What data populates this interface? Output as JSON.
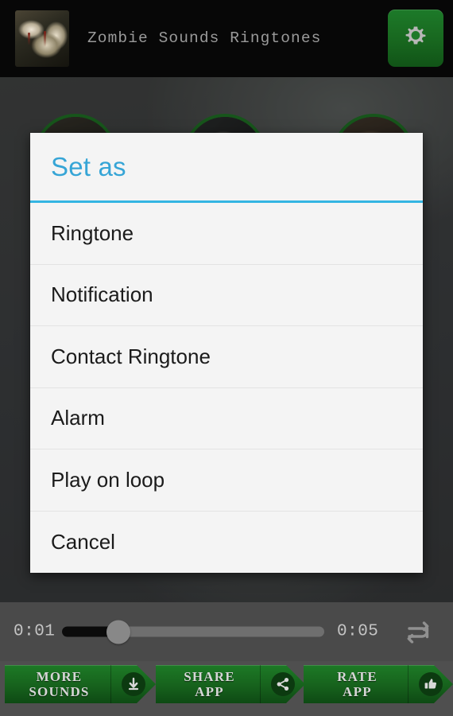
{
  "header": {
    "app_title": "Zombie Sounds Ringtones",
    "app_icon_name": "zombie-face-thumbnail",
    "settings_icon": "gear-icon"
  },
  "dialog": {
    "title": "Set as",
    "accent_color": "#34b5e2",
    "background_color": "#f4f4f4",
    "items": [
      {
        "label": "Ringtone"
      },
      {
        "label": "Notification"
      },
      {
        "label": "Contact Ringtone"
      },
      {
        "label": "Alarm"
      },
      {
        "label": "Play on loop"
      },
      {
        "label": "Cancel"
      }
    ]
  },
  "player": {
    "current_time": "0:01",
    "total_time": "0:05",
    "progress_percent": 20,
    "loop_icon": "repeat-icon",
    "track_color": "#6f6f6f",
    "fill_color": "#0b0b0b"
  },
  "bottom_bar": {
    "buttons": [
      {
        "label": "MORE\nSOUNDS",
        "icon": "download-icon"
      },
      {
        "label": "SHARE\nAPP",
        "icon": "share-icon"
      },
      {
        "label": "RATE\nAPP",
        "icon": "thumbs-up-icon"
      }
    ],
    "button_color": "#17631d"
  }
}
